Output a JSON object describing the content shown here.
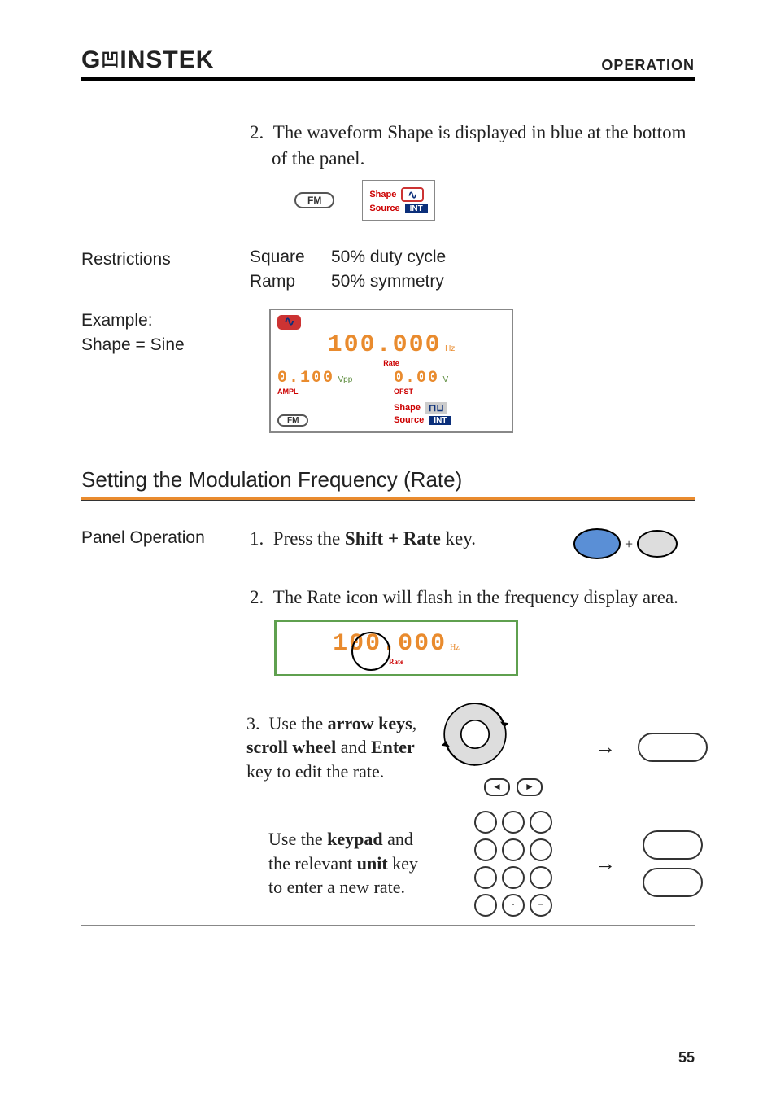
{
  "header": {
    "brand_prefix": "G",
    "brand_rest": "INSTEK",
    "section": "OPERATION"
  },
  "step2": {
    "num": "2.",
    "text": "The waveform Shape is displayed in blue at the bottom of the panel."
  },
  "fig1": {
    "pill": "FM",
    "shape_label": "Shape",
    "shape_wave_glyph": "∿",
    "source_label": "Source",
    "source_value": "INT"
  },
  "restrictions": {
    "label": "Restrictions",
    "rows": [
      {
        "shape": "Square",
        "note": "50% duty cycle"
      },
      {
        "shape": "Ramp",
        "note": "50% symmetry"
      }
    ]
  },
  "example": {
    "label_line1": "Example:",
    "label_line2": "Shape = Sine",
    "panel": {
      "wave_glyph": "∿",
      "rate_value": "100.000",
      "rate_unit": "Hz",
      "rate_caption": "Rate",
      "ampl_value": "0.100",
      "ampl_unit": "Vpp",
      "ampl_caption": "AMPL",
      "ofst_value": "0.00",
      "ofst_unit": "V",
      "ofst_caption": "OFST",
      "fm_pill": "FM",
      "shape_label": "Shape",
      "shape_chip_glyph": "⊓⊔",
      "source_label": "Source",
      "source_value": "INT"
    }
  },
  "heading": "Setting the Modulation Frequency (Rate)",
  "panel_op": {
    "label": "Panel Operation",
    "step1_num": "1.",
    "step1_text_pre": "Press the ",
    "step1_bold": "Shift + Rate",
    "step1_text_post": " key.",
    "plus": "+"
  },
  "rate_step2": {
    "num": "2.",
    "text": "The Rate icon will flash in the frequency display area.",
    "value": "100.000",
    "unit": "Hz",
    "caption": "Rate"
  },
  "rate_step3": {
    "num": "3.",
    "pre": "Use the ",
    "b1": "arrow keys",
    "mid1": ", ",
    "b2": "scroll wheel",
    "mid2": " and ",
    "b3": "Enter",
    "post1": " key to edit the rate.",
    "arrow": "→",
    "left_glyph": "◄",
    "right_glyph": "►",
    "para2_pre": "Use the ",
    "para2_b1": "keypad",
    "para2_mid1": " and the relevant ",
    "para2_b2": "unit",
    "para2_post": " key to enter a new rate.",
    "key_dot": "·",
    "key_neg": "−"
  },
  "page_no": "55"
}
